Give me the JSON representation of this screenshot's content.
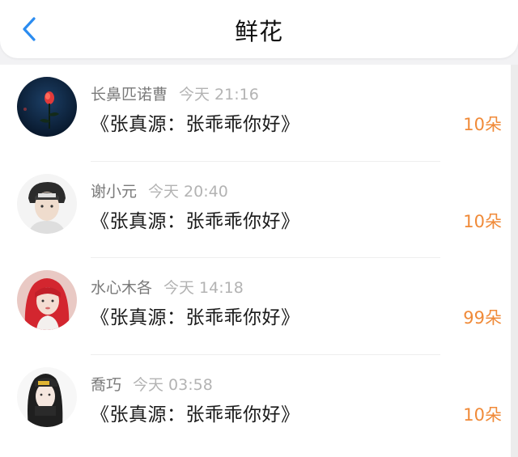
{
  "header": {
    "title": "鲜花",
    "back_icon": "chevron-left-icon",
    "accent": "#2b8cf0"
  },
  "colors": {
    "count": "#f08a38"
  },
  "items": [
    {
      "name": "长鼻匹诺曹",
      "time": "今天 21:16",
      "gift": "《张真源：张乖乖你好》",
      "count": "10朵"
    },
    {
      "name": "谢小元",
      "time": "今天 20:40",
      "gift": "《张真源：张乖乖你好》",
      "count": "10朵"
    },
    {
      "name": "水心木各",
      "time": "今天 14:18",
      "gift": "《张真源：张乖乖你好》",
      "count": "99朵"
    },
    {
      "name": "喬巧",
      "time": "今天 03:58",
      "gift": "《张真源：张乖乖你好》",
      "count": "10朵"
    }
  ]
}
